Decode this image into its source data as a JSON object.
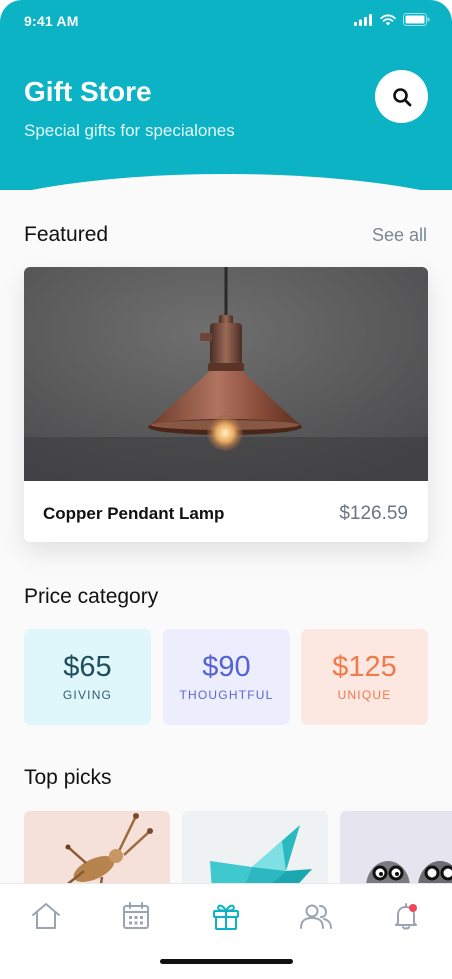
{
  "status_bar": {
    "time": "9:41 AM"
  },
  "header": {
    "title": "Gift Store",
    "subtitle": "Special gifts for specialones"
  },
  "featured": {
    "heading": "Featured",
    "see_all": "See all",
    "item": {
      "name": "Copper Pendant Lamp",
      "price": "$126.59"
    }
  },
  "price_category": {
    "heading": "Price category",
    "tiles": [
      {
        "amount": "$65",
        "label": "GIVING",
        "bg": "#dff6fb",
        "color": "#1e4d5c"
      },
      {
        "amount": "$90",
        "label": "THOUGHTFUL",
        "bg": "#eceefe",
        "color": "#5562d3"
      },
      {
        "amount": "$125",
        "label": "UNIQUE",
        "bg": "#fde7e1",
        "color": "#f07a4a"
      }
    ]
  },
  "top_picks": {
    "heading": "Top picks"
  },
  "tab_bar": {
    "tabs": [
      {
        "icon": "home-icon",
        "active": false
      },
      {
        "icon": "calendar-icon",
        "active": false
      },
      {
        "icon": "gift-icon",
        "active": true
      },
      {
        "icon": "friends-icon",
        "active": false
      },
      {
        "icon": "bell-icon",
        "active": false,
        "badge": true
      }
    ]
  },
  "colors": {
    "accent": "#0bb3c4",
    "inactive_icon": "#9aa5b1",
    "badge": "#f2455a"
  }
}
